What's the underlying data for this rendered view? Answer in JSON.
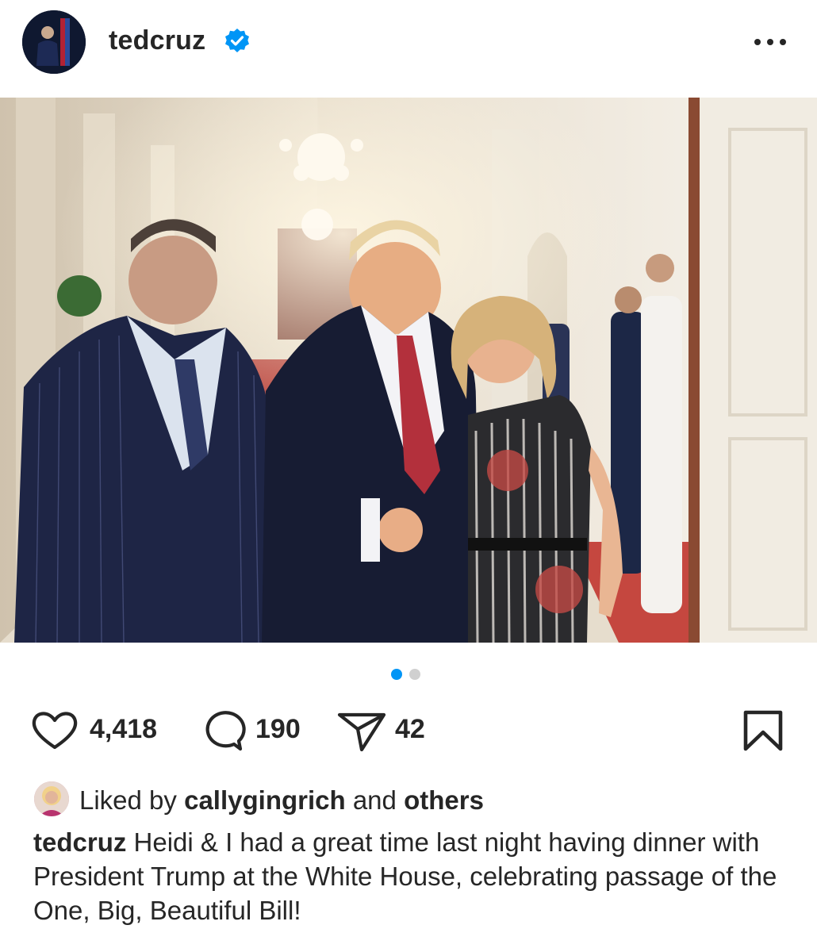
{
  "post": {
    "username": "tedcruz",
    "verified": true,
    "photo_alt": "Ted Cruz, Donald Trump and Heidi Cruz posing in a White House hallway",
    "carousel": {
      "current": 1,
      "total": 2
    }
  },
  "actions": {
    "likes": "4,418",
    "comments": "190",
    "shares": "42"
  },
  "liked_by": {
    "prefix": "Liked by",
    "user": "callygingrich",
    "conjunction": "and",
    "others": "others"
  },
  "caption": {
    "username": "tedcruz",
    "text": "Heidi & I had a great time last night having dinner with President Trump at the White House, celebrating passage of the One, Big, Beautiful Bill!"
  },
  "icons": {
    "more": "more-horizontal-icon",
    "like": "heart-icon",
    "comment": "comment-bubble-icon",
    "share": "paper-plane-icon",
    "save": "bookmark-icon",
    "verified": "verified-badge-icon"
  },
  "colors": {
    "text": "#262626",
    "verified": "#0095f6",
    "dot_active": "#0095f6",
    "dot_inactive": "#d0d0d0"
  }
}
